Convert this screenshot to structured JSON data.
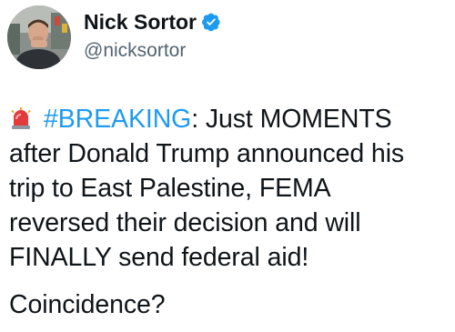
{
  "author": {
    "display_name": "Nick Sortor",
    "handle": "@nicksortor",
    "verified_color": "#1d9bf0",
    "avatar_icon": "profile-photo"
  },
  "tweet": {
    "emoji": "siren-icon",
    "hashtag": "#BREAKING",
    "lines": [
      ": Just MOMENTS",
      "after Donald Trump announced his",
      "trip to East Palestine, FEMA",
      "reversed their decision and will",
      "FINALLY send federal aid!"
    ],
    "closing": "Coincidence?"
  },
  "colors": {
    "text": "#0f1419",
    "secondary": "#536471",
    "link": "#1d9bf0"
  }
}
